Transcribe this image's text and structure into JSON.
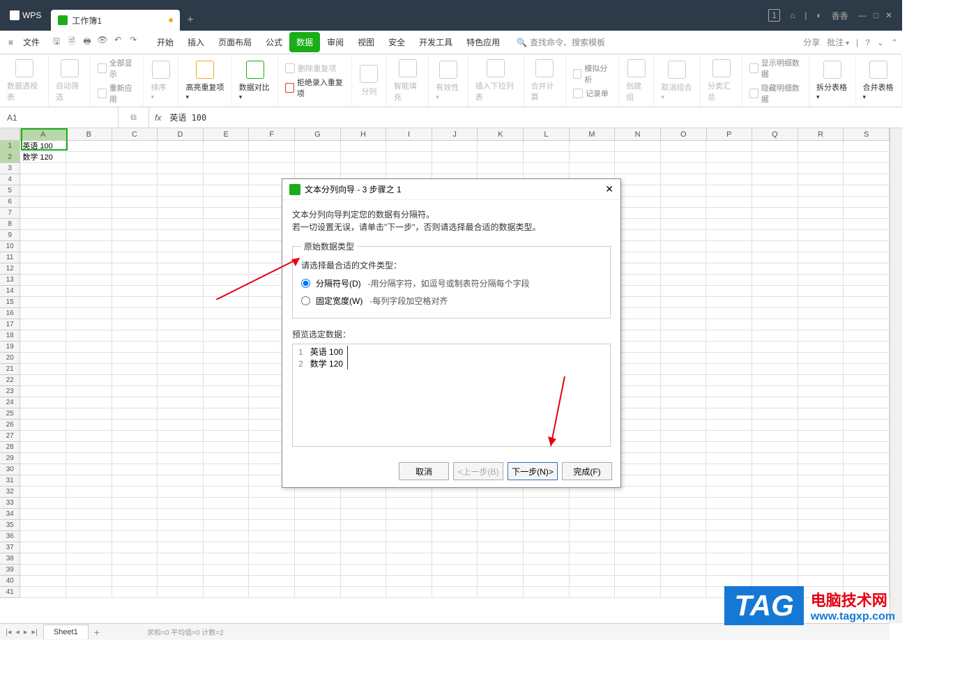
{
  "titlebar": {
    "app": "WPS",
    "tab": "工作簿1",
    "newtab": "+",
    "badge": "1",
    "user": "香香"
  },
  "menubar": {
    "file": "文件",
    "tabs": [
      "开始",
      "插入",
      "页面布局",
      "公式",
      "数据",
      "审阅",
      "视图",
      "安全",
      "开发工具",
      "特色应用"
    ],
    "active_index": 4,
    "search_placeholder": "查找命令、搜索模板",
    "share": "分享",
    "annotate": "批注"
  },
  "ribbon": {
    "g1": "数据透视表",
    "g2": "自动筛选",
    "g2a": "全部显示",
    "g2b": "重新应用",
    "g3": "排序",
    "g4": "高亮重复项",
    "g5": "数据对比",
    "g6a": "删除重复项",
    "g6b": "拒绝录入重复项",
    "g7": "分列",
    "g8": "智能填充",
    "g9": "有效性",
    "g10": "插入下拉列表",
    "g11": "合并计算",
    "g12a": "模拟分析",
    "g12b": "记录单",
    "g13": "创建组",
    "g14": "取消组合",
    "g15": "分类汇总",
    "g16a": "显示明细数据",
    "g16b": "隐藏明细数据",
    "g17": "拆分表格",
    "g18": "合并表格"
  },
  "fxbar": {
    "namebox": "A1",
    "formula": "英语 100"
  },
  "cols": [
    "A",
    "B",
    "C",
    "D",
    "E",
    "F",
    "G",
    "H",
    "I",
    "J",
    "K",
    "L",
    "M",
    "N",
    "O",
    "P",
    "Q",
    "R",
    "S"
  ],
  "rowcount": 41,
  "cells": {
    "A1": "英语 100",
    "A2": "数学 120"
  },
  "sheetbar": {
    "sheet": "Sheet1",
    "status": "求和=0  平均值=0  计数=2"
  },
  "dialog": {
    "title": "文本分列向导 - 3 步骤之 1",
    "line1": "文本分列向导判定您的数据有分隔符。",
    "line2": "若一切设置无误，请单击\"下一步\"，否则请选择最合适的数据类型。",
    "legend": "原始数据类型",
    "choose_label": "请选择最合适的文件类型：",
    "radio1_label": "分隔符号(D)",
    "radio1_desc": "-用分隔字符，如逗号或制表符分隔每个字段",
    "radio2_label": "固定宽度(W)",
    "radio2_desc": "-每列字段加空格对齐",
    "preview_label": "预览选定数据：",
    "preview_rows": [
      {
        "n": "1",
        "v": "英语 100"
      },
      {
        "n": "2",
        "v": "数学 120"
      }
    ],
    "btn_cancel": "取消",
    "btn_back": "<上一步(B)",
    "btn_next": "下一步(N)>",
    "btn_finish": "完成(F)"
  },
  "watermark": {
    "badge": "TAG",
    "line1": "电脑技术网",
    "line2": "www.tagxp.com"
  }
}
